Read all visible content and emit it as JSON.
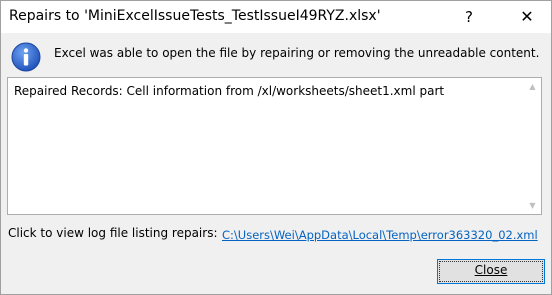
{
  "window": {
    "title": "Repairs to 'MiniExcelIssueTests_TestIssueI49RYZ.xlsx'",
    "help_glyph": "?",
    "close_glyph": "✕"
  },
  "message": "Excel was able to open the file by repairing or removing the unreadable content.",
  "details": "Repaired Records: Cell information from /xl/worksheets/sheet1.xml part",
  "log": {
    "label": "Click to view log file listing repairs:",
    "link": "C:\\Users\\Wei\\AppData\\Local\\Temp\\error363320_02.xml"
  },
  "buttons": {
    "close_label": "Close"
  },
  "icons": {
    "info": "info-icon",
    "scroll_up": "scroll-up-arrow-icon",
    "scroll_down": "scroll-down-arrow-icon"
  },
  "colors": {
    "info_icon": "#2a62c9",
    "link": "#0563c1",
    "button_border": "#0078d7"
  }
}
